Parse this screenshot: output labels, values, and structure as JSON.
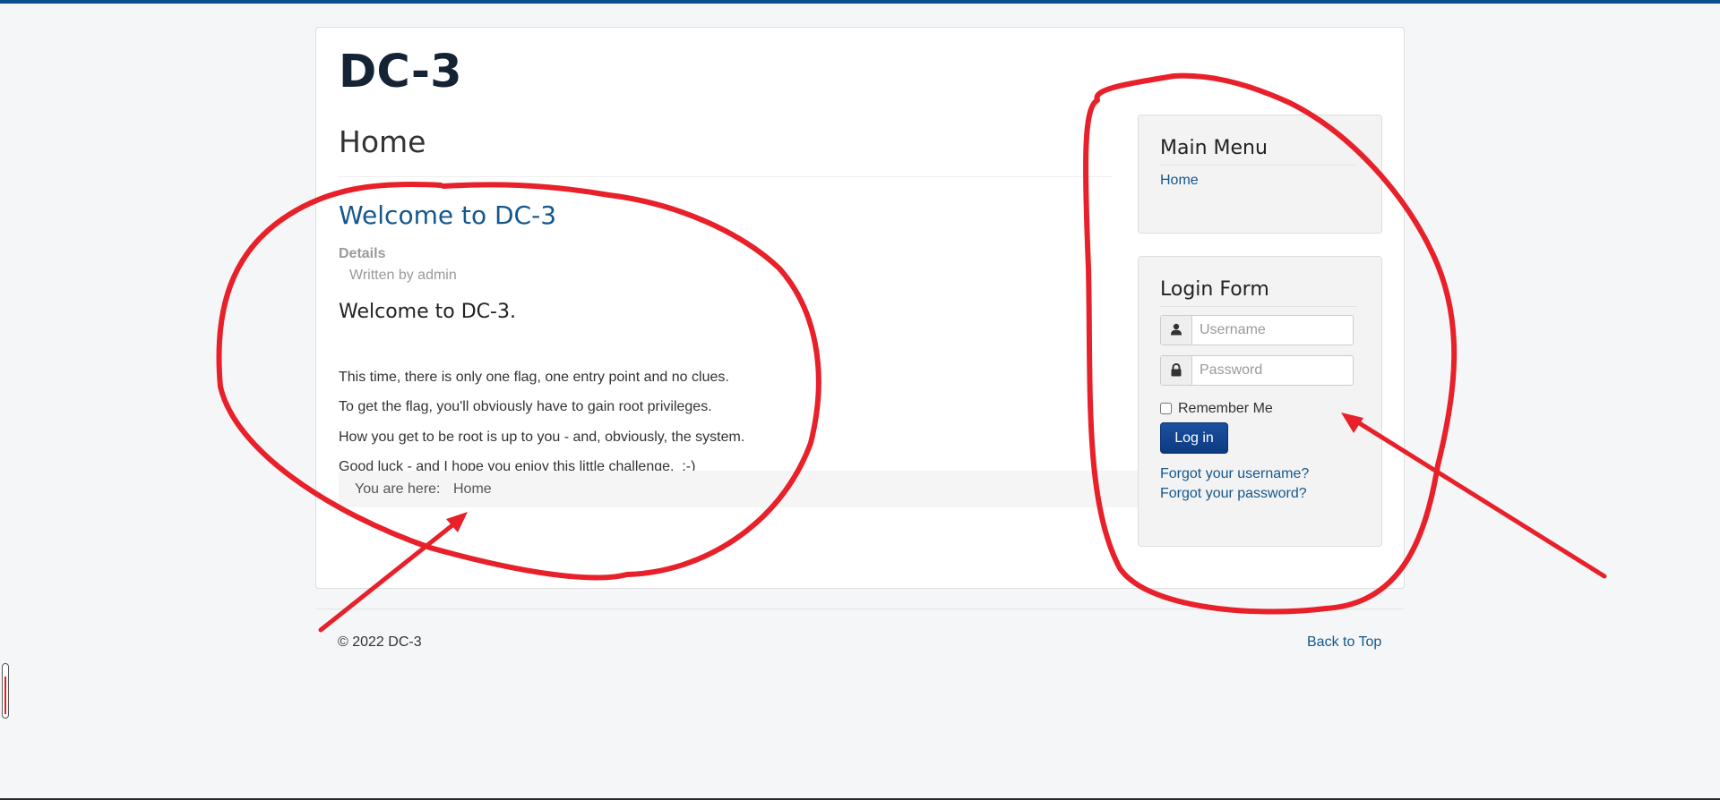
{
  "site": {
    "title": "DC-3"
  },
  "page": {
    "heading": "Home"
  },
  "article": {
    "title": "Welcome to DC-3",
    "details_label": "Details",
    "author": "Written by admin",
    "subtitle": "Welcome to DC-3.",
    "paragraphs": [
      "This time, there is only one flag, one entry point and no clues.",
      "To get the flag, you'll obviously have to gain root privileges.",
      "How you get to be root is up to you - and, obviously, the system.",
      "Good luck - and I hope you enjoy this little challenge.  :-)"
    ]
  },
  "breadcrumb": {
    "prefix": "You are here:",
    "current": "Home"
  },
  "main_menu": {
    "title": "Main Menu",
    "items": [
      {
        "label": "Home"
      }
    ]
  },
  "login_form": {
    "title": "Login Form",
    "username_placeholder": "Username",
    "password_placeholder": "Password",
    "remember_label": "Remember Me",
    "remember_checked": false,
    "submit_label": "Log in",
    "forgot_username": "Forgot your username?",
    "forgot_password": "Forgot your password?",
    "username_icon": "user-icon",
    "password_icon": "lock-icon"
  },
  "footer": {
    "copyright": "© 2022 DC-3",
    "back_to_top": "Back to Top"
  },
  "theme": {
    "accent": "#15578c",
    "top_bar": "#08518c",
    "button": "#0c3b82",
    "annotation": "#e8202a"
  }
}
